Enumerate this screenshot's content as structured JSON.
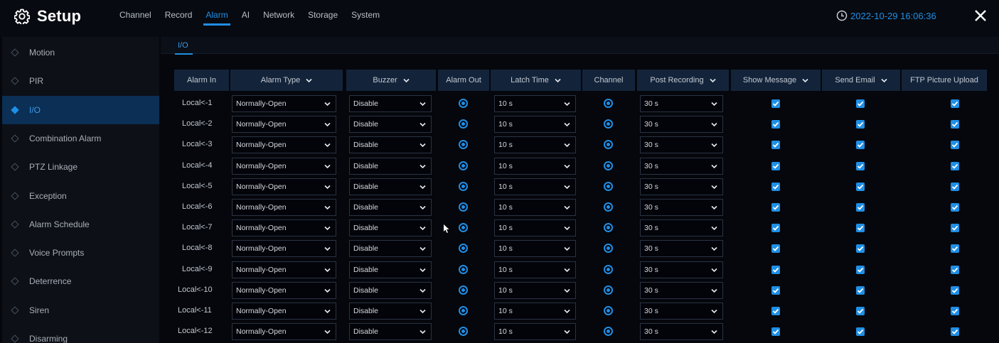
{
  "header": {
    "title": "Setup",
    "nav": [
      "Channel",
      "Record",
      "Alarm",
      "AI",
      "Network",
      "Storage",
      "System"
    ],
    "active_nav": "Alarm",
    "datetime": "2022-10-29 16:06:36",
    "accent_color": "#1f8fe6"
  },
  "sidebar": {
    "items": [
      {
        "label": "Motion"
      },
      {
        "label": "PIR"
      },
      {
        "label": "I/O"
      },
      {
        "label": "Combination Alarm"
      },
      {
        "label": "PTZ Linkage"
      },
      {
        "label": "Exception"
      },
      {
        "label": "Alarm Schedule"
      },
      {
        "label": "Voice Prompts"
      },
      {
        "label": "Deterrence"
      },
      {
        "label": "Siren"
      },
      {
        "label": "Disarming"
      }
    ],
    "active": "I/O"
  },
  "subtab": "I/O",
  "table": {
    "columns": [
      {
        "label": "Alarm In",
        "dropdown": false
      },
      {
        "label": "Alarm Type",
        "dropdown": true
      },
      {
        "label": "Buzzer",
        "dropdown": true
      },
      {
        "label": "Alarm Out",
        "dropdown": false
      },
      {
        "label": "Latch Time",
        "dropdown": true
      },
      {
        "label": "Channel",
        "dropdown": false
      },
      {
        "label": "Post Recording",
        "dropdown": true
      },
      {
        "label": "Show Message",
        "dropdown": true
      },
      {
        "label": "Send Email",
        "dropdown": true
      },
      {
        "label": "FTP Picture Upload",
        "dropdown": false
      }
    ],
    "rows": [
      {
        "alarm_in": "Local<-1",
        "alarm_type": "Normally-Open",
        "buzzer": "Disable",
        "latch_time": "10 s",
        "post_recording": "30 s",
        "show_message": true,
        "send_email": true,
        "ftp_upload": true
      },
      {
        "alarm_in": "Local<-2",
        "alarm_type": "Normally-Open",
        "buzzer": "Disable",
        "latch_time": "10 s",
        "post_recording": "30 s",
        "show_message": true,
        "send_email": true,
        "ftp_upload": true
      },
      {
        "alarm_in": "Local<-3",
        "alarm_type": "Normally-Open",
        "buzzer": "Disable",
        "latch_time": "10 s",
        "post_recording": "30 s",
        "show_message": true,
        "send_email": true,
        "ftp_upload": true
      },
      {
        "alarm_in": "Local<-4",
        "alarm_type": "Normally-Open",
        "buzzer": "Disable",
        "latch_time": "10 s",
        "post_recording": "30 s",
        "show_message": true,
        "send_email": true,
        "ftp_upload": true
      },
      {
        "alarm_in": "Local<-5",
        "alarm_type": "Normally-Open",
        "buzzer": "Disable",
        "latch_time": "10 s",
        "post_recording": "30 s",
        "show_message": true,
        "send_email": true,
        "ftp_upload": true
      },
      {
        "alarm_in": "Local<-6",
        "alarm_type": "Normally-Open",
        "buzzer": "Disable",
        "latch_time": "10 s",
        "post_recording": "30 s",
        "show_message": true,
        "send_email": true,
        "ftp_upload": true
      },
      {
        "alarm_in": "Local<-7",
        "alarm_type": "Normally-Open",
        "buzzer": "Disable",
        "latch_time": "10 s",
        "post_recording": "30 s",
        "show_message": true,
        "send_email": true,
        "ftp_upload": true
      },
      {
        "alarm_in": "Local<-8",
        "alarm_type": "Normally-Open",
        "buzzer": "Disable",
        "latch_time": "10 s",
        "post_recording": "30 s",
        "show_message": true,
        "send_email": true,
        "ftp_upload": true
      },
      {
        "alarm_in": "Local<-9",
        "alarm_type": "Normally-Open",
        "buzzer": "Disable",
        "latch_time": "10 s",
        "post_recording": "30 s",
        "show_message": true,
        "send_email": true,
        "ftp_upload": true
      },
      {
        "alarm_in": "Local<-10",
        "alarm_type": "Normally-Open",
        "buzzer": "Disable",
        "latch_time": "10 s",
        "post_recording": "30 s",
        "show_message": true,
        "send_email": true,
        "ftp_upload": true
      },
      {
        "alarm_in": "Local<-11",
        "alarm_type": "Normally-Open",
        "buzzer": "Disable",
        "latch_time": "10 s",
        "post_recording": "30 s",
        "show_message": true,
        "send_email": true,
        "ftp_upload": true
      },
      {
        "alarm_in": "Local<-12",
        "alarm_type": "Normally-Open",
        "buzzer": "Disable",
        "latch_time": "10 s",
        "post_recording": "30 s",
        "show_message": true,
        "send_email": true,
        "ftp_upload": true
      }
    ]
  }
}
